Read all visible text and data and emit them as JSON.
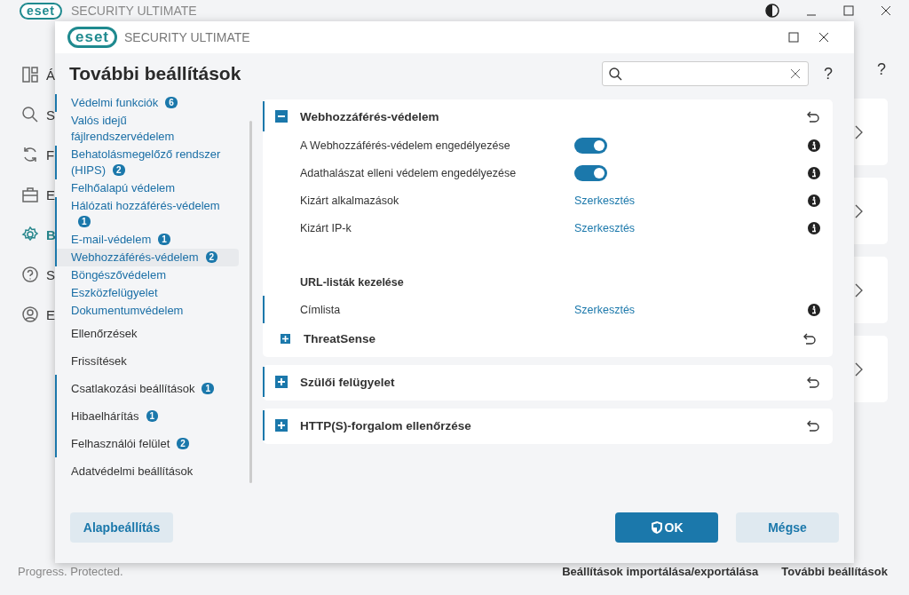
{
  "app": {
    "logo": "eset",
    "title": "SECURITY ULTIMATE",
    "nav": [
      {
        "label": "Á",
        "selected": false
      },
      {
        "label": "S",
        "selected": false
      },
      {
        "label": "F",
        "selected": false
      },
      {
        "label": "E",
        "selected": false
      },
      {
        "label": "B",
        "selected": true
      },
      {
        "label": "S",
        "selected": false
      },
      {
        "label": "E",
        "selected": false
      }
    ],
    "help": "?",
    "status": "Progress. Protected.",
    "footer_links": [
      "Beállítások importálása/exportálása",
      "További beállítások"
    ]
  },
  "dialog": {
    "logo": "eset",
    "title": "SECURITY ULTIMATE",
    "heading": "További beállítások",
    "help": "?",
    "sidebar": [
      {
        "label": "Védelmi funkciók",
        "badge": "6",
        "selected": false,
        "children": [
          {
            "label": "Valós idejű fájlrendszervédelem",
            "selected": false
          },
          {
            "label": "Behatolásmegelőző rendszer (HIPS)",
            "badge": "2",
            "selected": false
          },
          {
            "label": "Felhőalapú védelem",
            "selected": false
          },
          {
            "label": "Hálózati hozzáférés-védelem",
            "badge": "1",
            "selected": false
          },
          {
            "label": "E-mail-védelem",
            "badge": "1",
            "selected": false
          },
          {
            "label": "Webhozzáférés-védelem",
            "badge": "2",
            "selected": true
          },
          {
            "label": "Böngészővédelem",
            "selected": false
          },
          {
            "label": "Eszközfelügyelet",
            "selected": false
          },
          {
            "label": "Dokumentumvédelem",
            "selected": false
          }
        ]
      },
      {
        "label": "Ellenőrzések",
        "selected": false
      },
      {
        "label": "Frissítések",
        "selected": false
      },
      {
        "label": "Csatlakozási beállítások",
        "badge": "1",
        "selected": false
      },
      {
        "label": "Hibaelhárítás",
        "badge": "1",
        "selected": false
      },
      {
        "label": "Felhasználói felület",
        "badge": "2",
        "selected": false
      },
      {
        "label": "Adatvédelmi beállítások",
        "selected": false
      }
    ],
    "sections": [
      {
        "title": "Webhozzáférés-védelem",
        "expanded": true,
        "changed": true,
        "rows": [
          {
            "kind": "toggle",
            "label": "A Webhozzáférés-védelem engedélyezése",
            "on": true,
            "changed": false
          },
          {
            "kind": "toggle",
            "label": "Adathalászat elleni védelem engedélyezése",
            "on": true,
            "changed": false
          },
          {
            "kind": "link",
            "label": "Kizárt alkalmazások",
            "value": "Szerkesztés",
            "changed": false
          },
          {
            "kind": "link",
            "label": "Kizárt IP-k",
            "value": "Szerkesztés",
            "changed": false
          },
          {
            "kind": "heading",
            "label": "URL-listák kezelése"
          },
          {
            "kind": "link",
            "label": "Címlista",
            "value": "Szerkesztés",
            "changed": true
          }
        ],
        "subsections": [
          {
            "title": "ThreatSense",
            "expanded": false
          }
        ]
      },
      {
        "title": "Szülői felügyelet",
        "expanded": false,
        "changed": true
      },
      {
        "title": "HTTP(S)-forgalom ellenőrzése",
        "expanded": false,
        "changed": true
      }
    ],
    "buttons": {
      "default": "Alapbeállítás",
      "ok": "OK",
      "cancel": "Mégse"
    }
  }
}
